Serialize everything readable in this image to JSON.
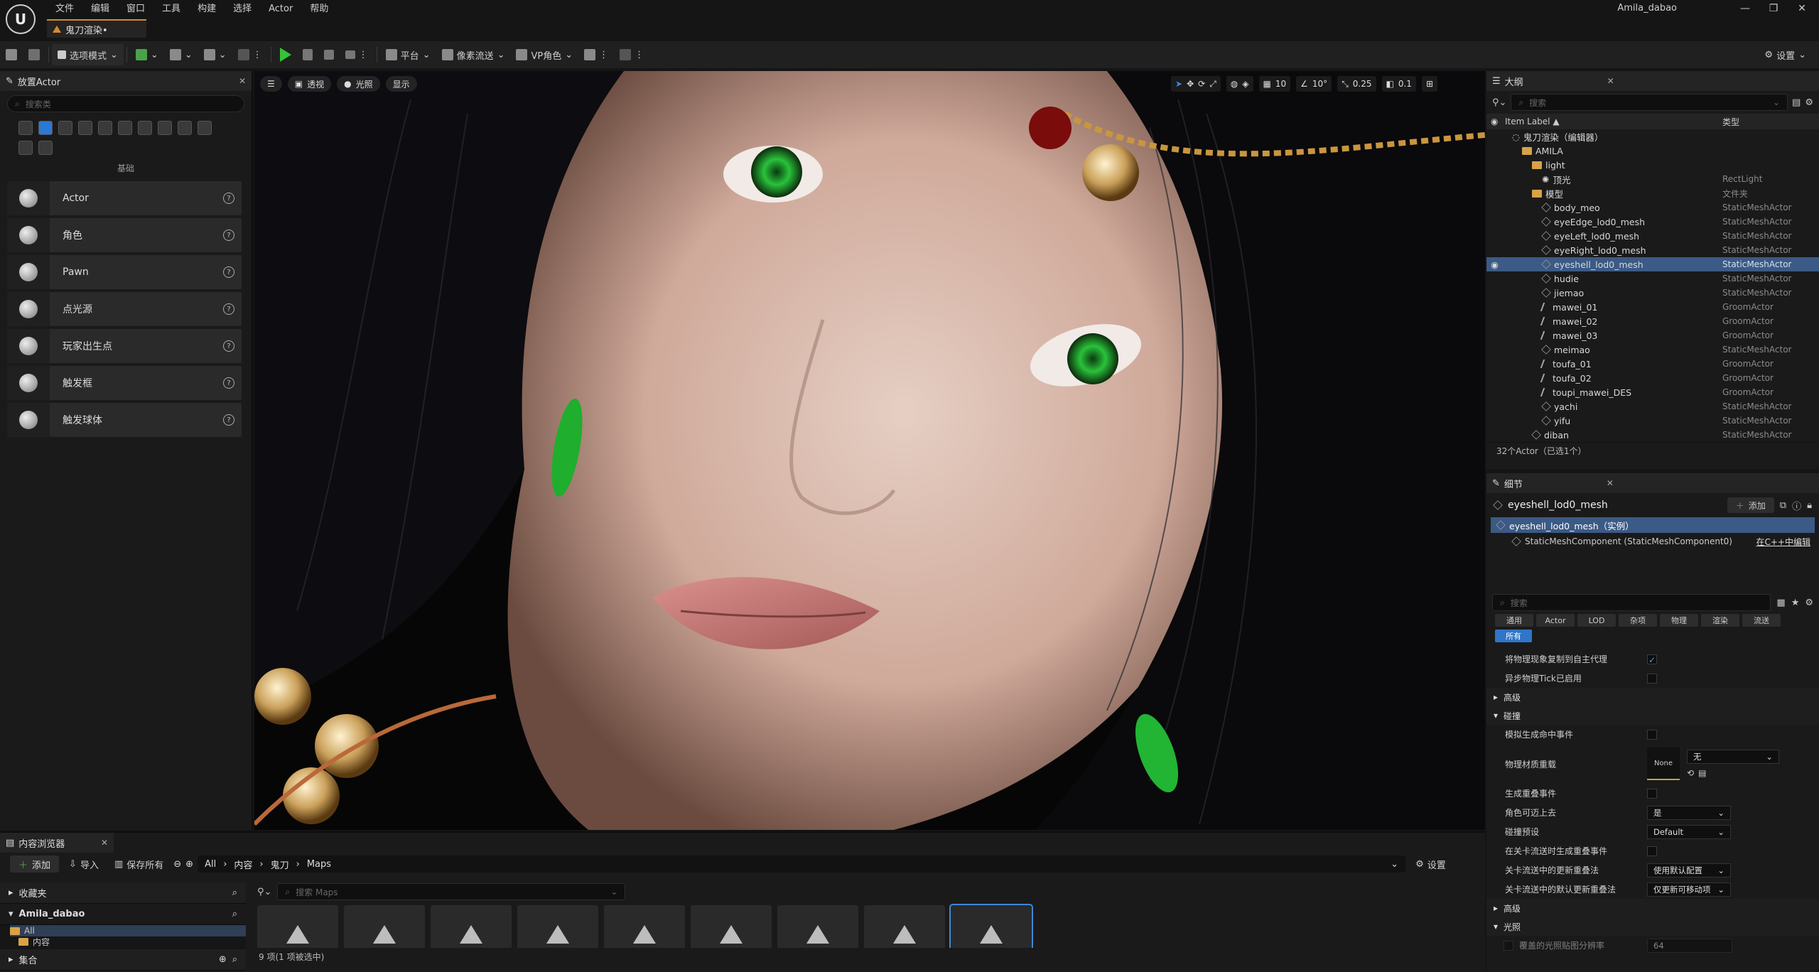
{
  "menu": [
    "文件",
    "编辑",
    "窗口",
    "工具",
    "构建",
    "选择",
    "Actor",
    "帮助"
  ],
  "doc_tab": "鬼刀渲染•",
  "user": "Amila_dabao",
  "window_controls": [
    "—",
    "❐",
    "✕"
  ],
  "toolbar": {
    "mode": "选项模式",
    "platform": "平台",
    "pixel_streaming": "像素流送",
    "vp_role": "VP角色",
    "settings": "设置"
  },
  "place_actor": {
    "tab": "放置Actor",
    "search_placeholder": "搜索类",
    "category": "基础",
    "items": [
      "Actor",
      "角色",
      "Pawn",
      "点光源",
      "玩家出生点",
      "触发框",
      "触发球体"
    ]
  },
  "viewport": {
    "perspective": "透视",
    "lit": "光照",
    "show": "显示",
    "grid": "10",
    "angle": "10°",
    "scale": "0.25",
    "camera_speed": "0.1"
  },
  "outliner": {
    "tab": "大纲",
    "search_placeholder": "搜索",
    "col_label": "Item Label ▲",
    "col_type": "类型",
    "rows": [
      {
        "name": "鬼刀渲染（编辑器）",
        "type": "",
        "indent": 1,
        "icon": "world"
      },
      {
        "name": "AMILA",
        "type": "",
        "indent": 2,
        "icon": "folder"
      },
      {
        "name": "light",
        "type": "",
        "indent": 3,
        "icon": "folder"
      },
      {
        "name": "顶光",
        "type": "RectLight",
        "indent": 4,
        "icon": "light"
      },
      {
        "name": "模型",
        "type": "文件夹",
        "indent": 3,
        "icon": "folder"
      },
      {
        "name": "body_meo",
        "type": "StaticMeshActor",
        "indent": 4,
        "icon": "mesh"
      },
      {
        "name": "eyeEdge_lod0_mesh",
        "type": "StaticMeshActor",
        "indent": 4,
        "icon": "mesh"
      },
      {
        "name": "eyeLeft_lod0_mesh",
        "type": "StaticMeshActor",
        "indent": 4,
        "icon": "mesh"
      },
      {
        "name": "eyeRight_lod0_mesh",
        "type": "StaticMeshActor",
        "indent": 4,
        "icon": "mesh"
      },
      {
        "name": "eyeshell_lod0_mesh",
        "type": "StaticMeshActor",
        "indent": 4,
        "icon": "mesh",
        "selected": true
      },
      {
        "name": "hudie",
        "type": "StaticMeshActor",
        "indent": 4,
        "icon": "mesh"
      },
      {
        "name": "jiemao",
        "type": "StaticMeshActor",
        "indent": 4,
        "icon": "mesh"
      },
      {
        "name": "mawei_01",
        "type": "GroomActor",
        "indent": 4,
        "icon": "groom"
      },
      {
        "name": "mawei_02",
        "type": "GroomActor",
        "indent": 4,
        "icon": "groom"
      },
      {
        "name": "mawei_03",
        "type": "GroomActor",
        "indent": 4,
        "icon": "groom"
      },
      {
        "name": "meimao",
        "type": "StaticMeshActor",
        "indent": 4,
        "icon": "mesh"
      },
      {
        "name": "toufa_01",
        "type": "GroomActor",
        "indent": 4,
        "icon": "groom"
      },
      {
        "name": "toufa_02",
        "type": "GroomActor",
        "indent": 4,
        "icon": "groom"
      },
      {
        "name": "toupi_mawei_DES",
        "type": "GroomActor",
        "indent": 4,
        "icon": "groom"
      },
      {
        "name": "yachi",
        "type": "StaticMeshActor",
        "indent": 4,
        "icon": "mesh"
      },
      {
        "name": "yifu",
        "type": "StaticMeshActor",
        "indent": 4,
        "icon": "mesh"
      },
      {
        "name": "diban",
        "type": "StaticMeshActor",
        "indent": 3,
        "icon": "mesh"
      }
    ],
    "status": "32个Actor（已选1个）"
  },
  "details": {
    "tab": "细节",
    "object": "eyeshell_lod0_mesh",
    "add": "添加",
    "instance": "eyeshell_lod0_mesh（实例）",
    "component": "StaticMeshComponent (StaticMeshComponent0)",
    "edit_cpp": "在C++中编辑",
    "search_placeholder": "搜索",
    "filters": [
      "通用",
      "Actor",
      "LOD",
      "杂项",
      "物理",
      "渲染",
      "流送"
    ],
    "filter_all": "所有",
    "props": [
      {
        "label": "将物理现象复制到自主代理",
        "kind": "check",
        "checked": true
      },
      {
        "label": "异步物理Tick已启用",
        "kind": "check",
        "checked": false
      }
    ],
    "section_advanced": "高级",
    "section_collision": "碰撞",
    "collision_props": [
      {
        "label": "模拟生成命中事件",
        "kind": "check"
      },
      {
        "label": "物理材质重载",
        "kind": "material"
      },
      {
        "label": "生成重叠事件",
        "kind": "check"
      },
      {
        "label": "角色可迈上去",
        "kind": "dd",
        "value": "是"
      },
      {
        "label": "碰撞预设",
        "kind": "dd",
        "value": "Default"
      },
      {
        "label": "在关卡流送时生成重叠事件",
        "kind": "check"
      },
      {
        "label": "关卡流送中的更新重叠法",
        "kind": "dd",
        "value": "使用默认配置"
      },
      {
        "label": "关卡流送中的默认更新重叠法",
        "kind": "dd",
        "value": "仅更新可移动项"
      }
    ],
    "material_none": "None",
    "material_value": "无",
    "section_advanced2": "高级",
    "section_lighting": "光照",
    "lighting_prop": "覆盖的光照贴图分辨率",
    "lighting_value": "64"
  },
  "content_browser": {
    "tab": "内容浏览器",
    "add": "添加",
    "import": "导入",
    "save_all": "保存所有",
    "path": [
      "All",
      "内容",
      "鬼刀",
      "Maps"
    ],
    "settings": "设置",
    "favorites": "收藏夹",
    "project": "Amila_dabao",
    "tree_all": "All",
    "tree_content": "内容",
    "collections": "集合",
    "search_placeholder": "搜索 Maps",
    "asset_count": 9,
    "status": "9 项(1 项被选中)"
  }
}
